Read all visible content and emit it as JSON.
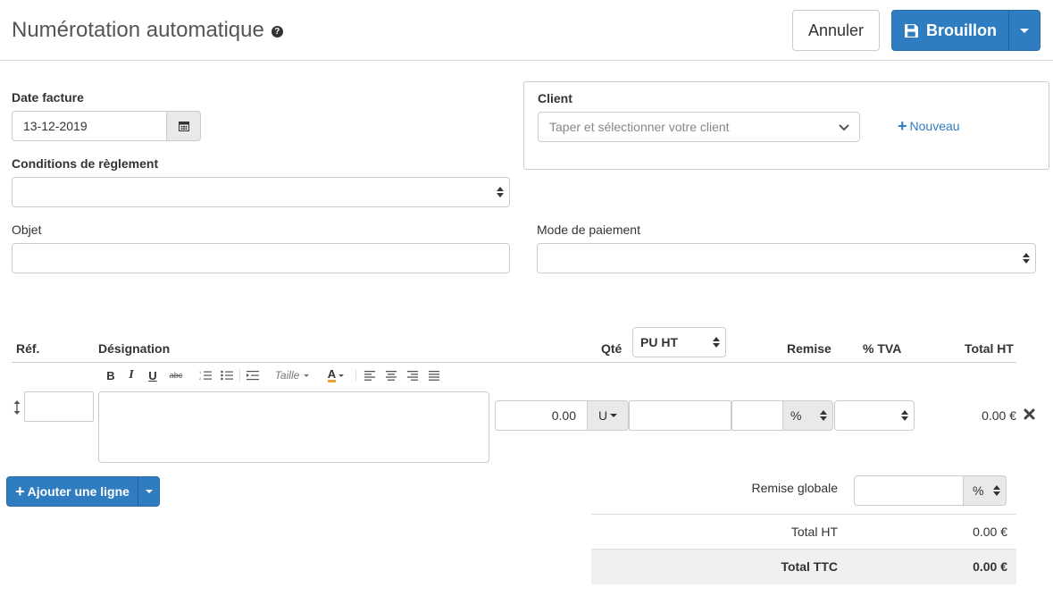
{
  "header": {
    "title": "Numérotation automatique",
    "cancel_label": "Annuler",
    "draft_label": "Brouillon"
  },
  "form": {
    "date_label": "Date facture",
    "date_value": "13-12-2019",
    "conditions_label": "Conditions de règlement",
    "conditions_value": "",
    "objet_label": "Objet",
    "objet_value": "",
    "client_label": "Client",
    "client_placeholder": "Taper et sélectionner votre client",
    "new_client_label": "Nouveau",
    "payment_mode_label": "Mode de paiement",
    "payment_mode_value": ""
  },
  "table": {
    "headers": {
      "ref": "Réf.",
      "designation": "Désignation",
      "qty": "Qté",
      "price_type": "PU HT",
      "discount": "Remise",
      "vat": "% TVA",
      "total": "Total HT"
    },
    "editor_size_label": "Taille",
    "row": {
      "ref": "",
      "designation": "",
      "qty": "0.00",
      "unit": "U",
      "unit_price": "",
      "discount": "",
      "discount_type": "%",
      "vat": "",
      "total": "0.00 €"
    }
  },
  "add_line_label": "Ajouter une ligne",
  "totals": {
    "global_discount_label": "Remise globale",
    "global_discount_value": "",
    "global_discount_type": "%",
    "total_ht_label": "Total HT",
    "total_ht_value": "0.00 €",
    "total_ttc_label": "Total TTC",
    "total_ttc_value": "0.00 €"
  },
  "colors": {
    "primary": "#2f7cc0",
    "border": "#cccccc",
    "addon_bg": "#e9e9e9",
    "total_row_bg": "#f0f0f0"
  }
}
